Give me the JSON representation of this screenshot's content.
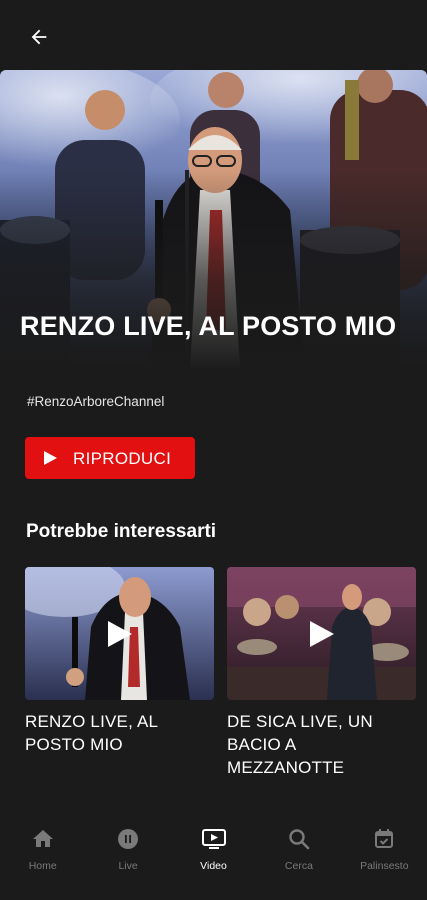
{
  "header": {
    "back_icon": "arrow-left-icon"
  },
  "hero": {
    "title": "RENZO LIVE, AL POSTO MIO",
    "hashtag": "#RenzoArboreChannel",
    "play_label": "RIPRODUCI",
    "play_color": "#e21010"
  },
  "related": {
    "heading": "Potrebbe interessarti",
    "items": [
      {
        "label": "RENZO LIVE, AL POSTO MIO"
      },
      {
        "label": "DE SICA LIVE, UN BACIO A MEZZANOTTE"
      }
    ]
  },
  "nav": {
    "items": [
      {
        "label": "Home",
        "icon": "home-icon",
        "active": false
      },
      {
        "label": "Live",
        "icon": "live-icon",
        "active": false
      },
      {
        "label": "Video",
        "icon": "video-icon",
        "active": true
      },
      {
        "label": "Cerca",
        "icon": "search-icon",
        "active": false
      },
      {
        "label": "Palinsesto",
        "icon": "calendar-icon",
        "active": false
      }
    ]
  }
}
